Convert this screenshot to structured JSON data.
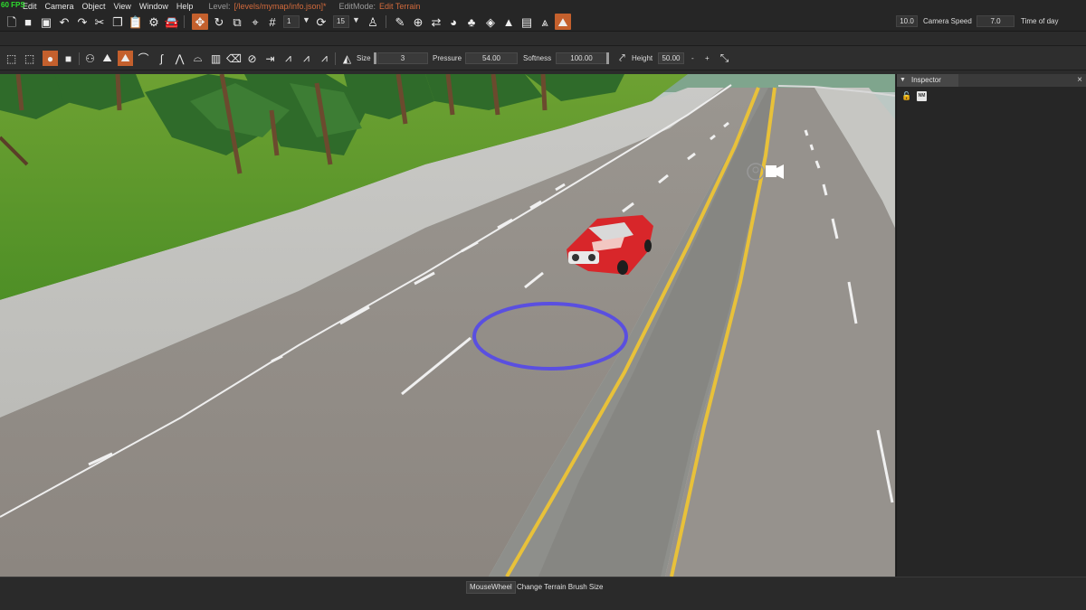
{
  "menubar": {
    "fps": "60 FPS",
    "items": [
      "Edit",
      "Camera",
      "Object",
      "View",
      "Window",
      "Help"
    ],
    "level_label": "Level:",
    "level_value": "[/levels/mymap/info.json]*",
    "editmode_label": "EditMode:",
    "editmode_value": "Edit Terrain"
  },
  "toolbar1": {
    "snap_grid_value": "1",
    "rotate_snap_value": "15",
    "icons": [
      "new-file",
      "open-folder",
      "save",
      "undo",
      "redo",
      "cut",
      "copy",
      "paste",
      "settings",
      "vehicle",
      "move",
      "rotate",
      "scale",
      "snap",
      "grid",
      "rotate-snap",
      "person",
      "pencil",
      "add",
      "road",
      "shape",
      "forest",
      "mesh",
      "terrain-paint",
      "decal-road",
      "terrain-edit"
    ]
  },
  "camera": {
    "speed_value": "10.0",
    "speed_label": "Camera Speed",
    "time_value": "7.0",
    "time_label": "Time of day"
  },
  "brush_toolbar": {
    "size_label": "Size",
    "size_value": "3",
    "pressure_label": "Pressure",
    "pressure_value": "54.00",
    "softness_label": "Softness",
    "softness_value": "100.00",
    "height_label": "Height",
    "height_value": "50.00",
    "minus": "-",
    "plus": "+"
  },
  "inspector": {
    "title": "Inspector",
    "close": "×",
    "pin_label": "NM"
  },
  "status": {
    "key": "MouseWheel",
    "action": "Change Terrain Brush Size"
  },
  "colors": {
    "accent": "#c4602d",
    "fps": "#2ee02e",
    "brush_ring": "#5a4fe0",
    "road_yellow": "#e8c13a",
    "car_red": "#d8262a"
  }
}
